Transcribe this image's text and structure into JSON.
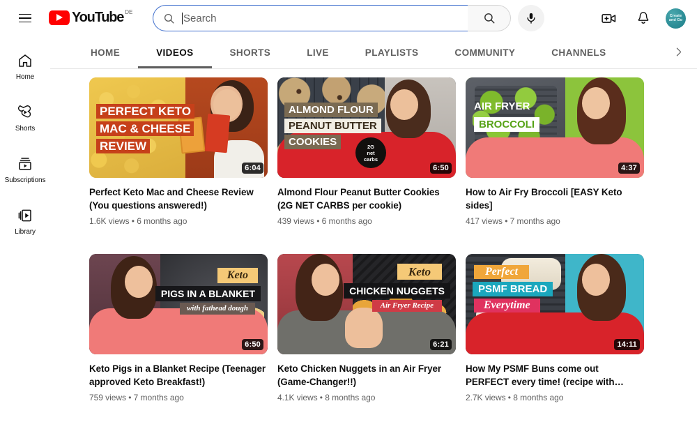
{
  "header": {
    "menu_icon": "hamburger-menu-icon",
    "logo_text": "YouTube",
    "logo_country_code": "DE",
    "search": {
      "placeholder": "Search",
      "value": "",
      "search_icon": "search-icon",
      "submit_icon": "search-icon",
      "voice_icon": "microphone-icon"
    },
    "create_icon": "create-video-icon",
    "notifications_icon": "bell-icon",
    "avatar": {
      "name": "channel-avatar",
      "line1": "Create",
      "line2": "and Go",
      "color": "#2e8f98"
    }
  },
  "sidebar": {
    "items": [
      {
        "label": "Home",
        "icon": "home-icon"
      },
      {
        "label": "Shorts",
        "icon": "shorts-icon"
      },
      {
        "label": "Subscriptions",
        "icon": "subscriptions-icon"
      },
      {
        "label": "Library",
        "icon": "library-icon"
      }
    ]
  },
  "tabs": {
    "items": [
      {
        "label": "HOME",
        "active": false
      },
      {
        "label": "VIDEOS",
        "active": true
      },
      {
        "label": "SHORTS",
        "active": false
      },
      {
        "label": "LIVE",
        "active": false
      },
      {
        "label": "PLAYLISTS",
        "active": false
      },
      {
        "label": "COMMUNITY",
        "active": false
      },
      {
        "label": "CHANNELS",
        "active": false
      }
    ],
    "overflow_icon": "chevron-right-icon"
  },
  "videos": [
    {
      "title": "Perfect Keto Mac and Cheese Review (You questions answered!)",
      "views": "1.6K views",
      "age": "6 months ago",
      "meta": "1.6K views • 6 months ago",
      "duration": "6:04",
      "thumbnail_text": [
        "PERFECT KETO",
        "MAC & CHEESE",
        "REVIEW"
      ]
    },
    {
      "title": "Almond Flour Peanut Butter Cookies (2G NET CARBS per cookie)",
      "views": "439 views",
      "age": "6 months ago",
      "meta": "439 views • 6 months ago",
      "duration": "6:50",
      "thumbnail_text": [
        "ALMOND FLOUR",
        "PEANUT BUTTER",
        "COOKIES"
      ],
      "thumbnail_badge": [
        "2G",
        "net",
        "carbs"
      ]
    },
    {
      "title": "How to Air Fry Broccoli [EASY Keto sides]",
      "views": "417 views",
      "age": "7 months ago",
      "meta": "417 views • 7 months ago",
      "duration": "4:37",
      "thumbnail_text": [
        "AIR FRYER",
        "BROCCOLI"
      ]
    },
    {
      "title": "Keto Pigs in a Blanket Recipe (Teenager approved Keto Breakfast!)",
      "views": "759 views",
      "age": "7 months ago",
      "meta": "759 views • 7 months ago",
      "duration": "6:50",
      "thumbnail_text": [
        "Keto",
        "PIGS IN A BLANKET",
        "with fathead dough"
      ]
    },
    {
      "title": "Keto Chicken Nuggets in an Air Fryer (Game-Changer!!)",
      "views": "4.1K views",
      "age": "8 months ago",
      "meta": "4.1K views • 8 months ago",
      "duration": "6:21",
      "thumbnail_text": [
        "Keto",
        "CHICKEN NUGGETS",
        "Air Fryer Recipe"
      ]
    },
    {
      "title": "How My PSMF Buns come out PERFECT every time! (recipe with…",
      "views": "2.7K views",
      "age": "8 months ago",
      "meta": "2.7K views • 8 months ago",
      "duration": "14:11",
      "thumbnail_text": [
        "Perfect",
        "PSMF BREAD",
        "Everytime"
      ]
    }
  ]
}
